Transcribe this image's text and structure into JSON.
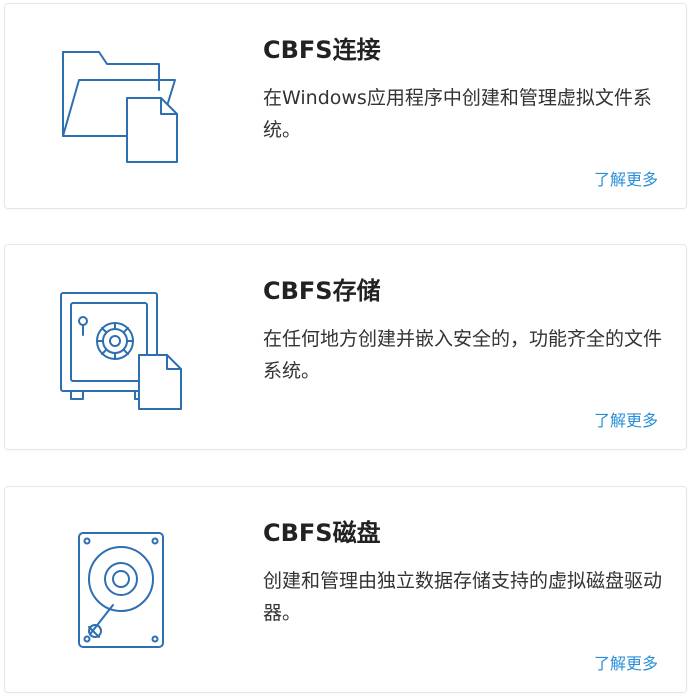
{
  "colors": {
    "accent": "#2a8fd6",
    "icon_stroke": "#2e6fb1",
    "title": "#222222",
    "text": "#333333",
    "card_border": "#e4e6e9"
  },
  "cards": [
    {
      "title": "CBFS连接",
      "description": "在Windows应用程序中创建和管理虚拟文件系统。",
      "link": "了解更多",
      "icon": "folder-document-icon"
    },
    {
      "title": "CBFS存储",
      "description": "在任何地方创建并嵌入安全的，功能齐全的文件系统。",
      "link": "了解更多",
      "icon": "safe-document-icon"
    },
    {
      "title": "CBFS磁盘",
      "description": "创建和管理由独立数据存储支持的虚拟磁盘驱动器。",
      "link": "了解更多",
      "icon": "hard-disk-icon"
    }
  ]
}
